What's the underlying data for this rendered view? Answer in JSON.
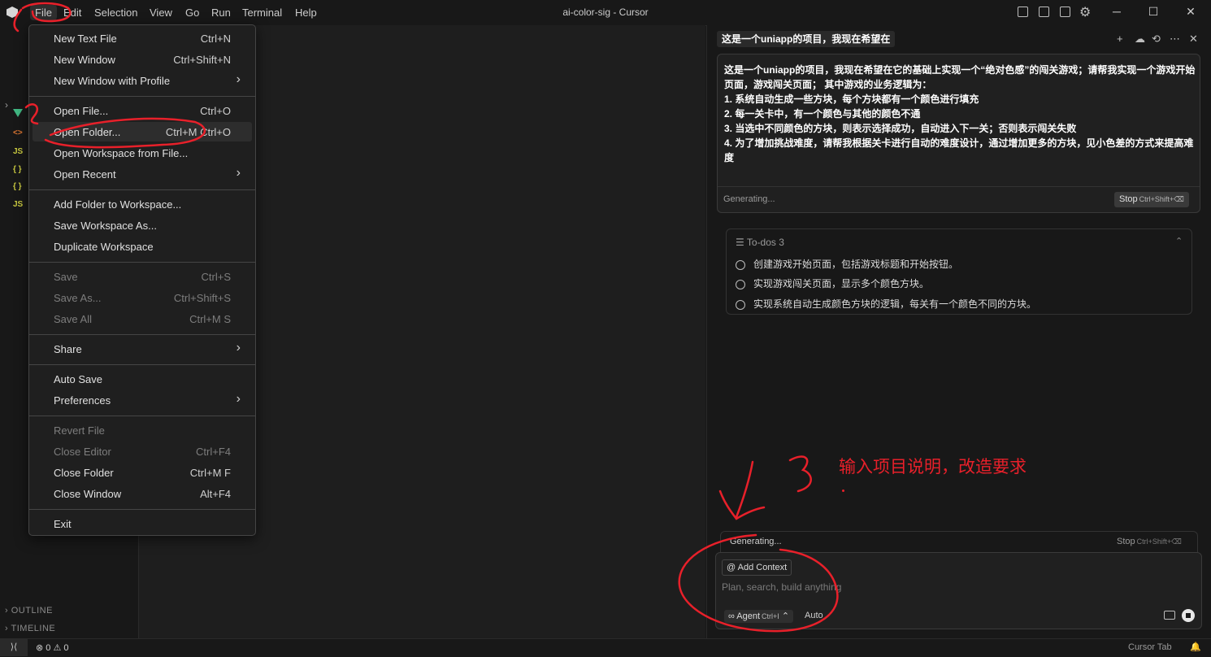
{
  "window": {
    "title": "ai-color-sig - Cursor",
    "menubar": [
      "File",
      "Edit",
      "Selection",
      "View",
      "Go",
      "Run",
      "Terminal",
      "Help"
    ],
    "controls": [
      "─",
      "☐",
      "✕"
    ]
  },
  "sidebar": {
    "glyphs": [
      {
        "text": "<>",
        "color": "#e37933"
      },
      {
        "text": "JS",
        "color": "#cbcb41"
      },
      {
        "text": "{ }",
        "color": "#cbcb41"
      },
      {
        "text": "{ }",
        "color": "#cbcb41"
      },
      {
        "text": "JS",
        "color": "#cbcb41"
      }
    ],
    "outline_label": "OUTLINE",
    "timeline_label": "TIMELINE"
  },
  "file_menu": {
    "items": [
      {
        "label": "New Text File",
        "kb": "Ctrl+N"
      },
      {
        "label": "New Window",
        "kb": "Ctrl+Shift+N"
      },
      {
        "label": "New Window with Profile",
        "kb": "",
        "submenu": true
      },
      {
        "sep": true
      },
      {
        "label": "Open File...",
        "kb": "Ctrl+O"
      },
      {
        "label": "Open Folder...",
        "kb": "Ctrl+M Ctrl+O",
        "hover": true
      },
      {
        "label": "Open Workspace from File...",
        "kb": ""
      },
      {
        "label": "Open Recent",
        "kb": "",
        "submenu": true
      },
      {
        "sep": true
      },
      {
        "label": "Add Folder to Workspace...",
        "kb": ""
      },
      {
        "label": "Save Workspace As...",
        "kb": ""
      },
      {
        "label": "Duplicate Workspace",
        "kb": ""
      },
      {
        "sep": true
      },
      {
        "label": "Save",
        "kb": "Ctrl+S",
        "disabled": true
      },
      {
        "label": "Save As...",
        "kb": "Ctrl+Shift+S",
        "disabled": true
      },
      {
        "label": "Save All",
        "kb": "Ctrl+M S",
        "disabled": true
      },
      {
        "sep": true
      },
      {
        "label": "Share",
        "kb": "",
        "submenu": true
      },
      {
        "sep": true
      },
      {
        "label": "Auto Save",
        "kb": ""
      },
      {
        "label": "Preferences",
        "kb": "",
        "submenu": true
      },
      {
        "sep": true
      },
      {
        "label": "Revert File",
        "kb": "",
        "disabled": true
      },
      {
        "label": "Close Editor",
        "kb": "Ctrl+F4",
        "disabled": true
      },
      {
        "label": "Close Folder",
        "kb": "Ctrl+M F"
      },
      {
        "label": "Close Window",
        "kb": "Alt+F4"
      },
      {
        "sep": true
      },
      {
        "label": "Exit",
        "kb": ""
      }
    ]
  },
  "chat": {
    "tab_title": "这是一个uniapp的项目，我现在希望在",
    "header_icons": [
      "+",
      "☁",
      "⟲",
      "⋯",
      "✕"
    ],
    "prompt_lines": [
      "这是一个uniapp的项目，我现在希望在它的基础上实现一个“绝对色感”的闯关游戏；请帮我实现一个游戏开始",
      "页面，游戏闯关页面； 其中游戏的业务逻辑为：",
      "1. 系统自动生成一些方块，每个方块都有一个颜色进行填充",
      "2. 每一关卡中，有一个颜色与其他的颜色不通",
      "3. 当选中不同颜色的方块，则表示选择成功，自动进入下一关；否则表示闯关失败",
      "4. 为了增加挑战难度，请帮我根据关卡进行自动的难度设计，通过增加更多的方块，见小色差的方式来提高难",
      "度"
    ],
    "generating_label": "Generating...",
    "stop_label": "Stop",
    "stop_kb": "Ctrl+Shift+⌫",
    "todos": {
      "title": "To-dos",
      "count": "3",
      "items": [
        "创建游戏开始页面，包括游戏标题和开始按钮。",
        "实现游戏闯关页面，显示多个颜色方块。",
        "实现系统自动生成颜色方块的逻辑，每关有一个颜色不同的方块。"
      ]
    },
    "composer": {
      "generating_label": "Generating...",
      "stop_label": "Stop",
      "stop_kb": "Ctrl+Shift+⌫",
      "add_context": "Add Context",
      "placeholder": "Plan, search, build anything",
      "agent_label": "Agent",
      "agent_kb": "Ctrl+I",
      "model_label": "Auto"
    }
  },
  "statusbar": {
    "problems": "⊗ 0 ⚠ 0",
    "cursor_tab": "Cursor Tab"
  },
  "annotation": {
    "text": "输入项目说明，改造要求",
    "color": "#e8202a"
  }
}
